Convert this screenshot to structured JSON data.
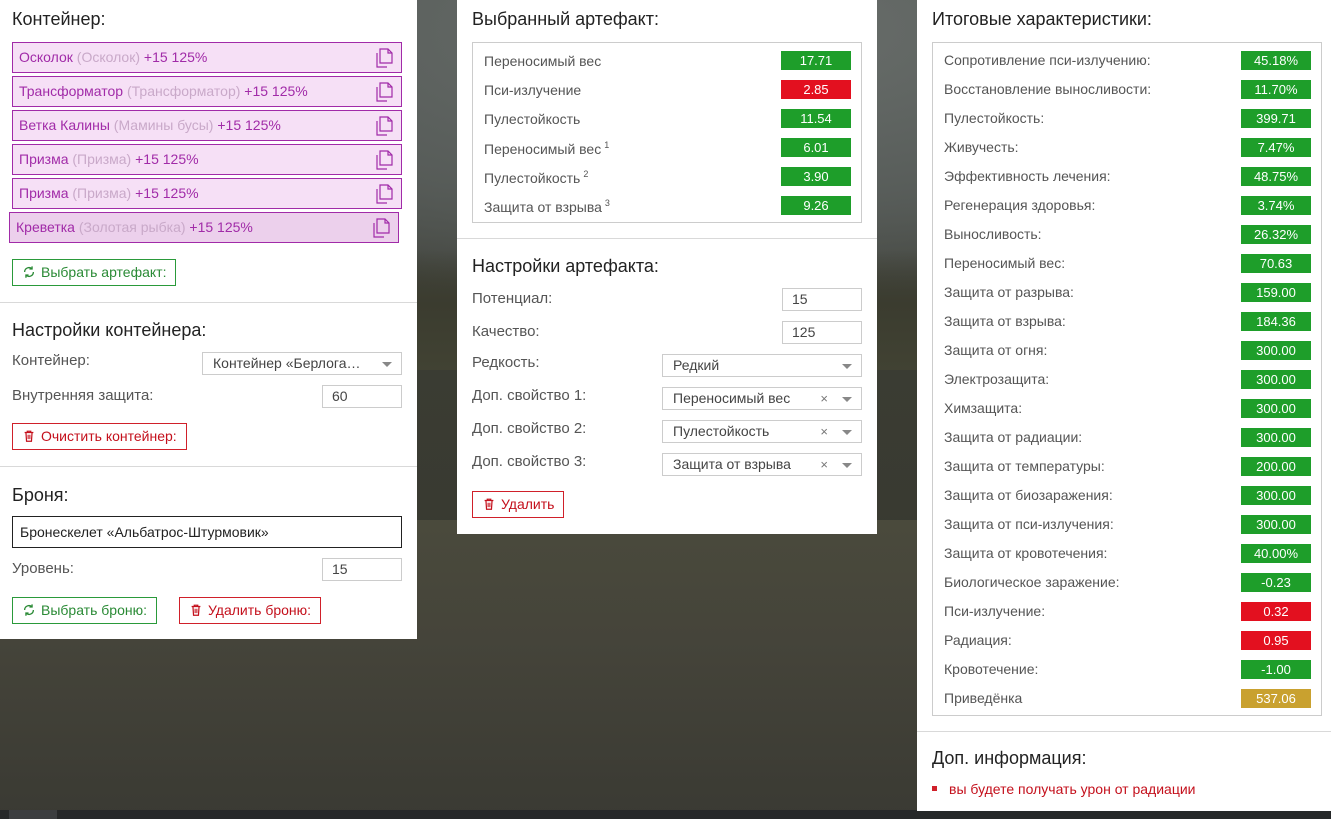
{
  "container_section": {
    "title": "Контейнер:",
    "artifacts": [
      {
        "name": "Осколок",
        "sub": "(Осколок)",
        "bonus": "+15 125%"
      },
      {
        "name": "Трансформатор",
        "sub": "(Трансформатор)",
        "bonus": "+15 125%"
      },
      {
        "name": "Ветка Калины",
        "sub": "(Мамины бусы)",
        "bonus": "+15 125%"
      },
      {
        "name": "Призма",
        "sub": "(Призма)",
        "bonus": "+15 125%"
      },
      {
        "name": "Призма",
        "sub": "(Призма)",
        "bonus": "+15 125%"
      },
      {
        "name": "Креветка",
        "sub": "(Золотая рыбка)",
        "bonus": "+15 125%"
      }
    ],
    "select_artifact_label": "Выбрать артефакт:"
  },
  "container_settings": {
    "title": "Настройки контейнера:",
    "container_label": "Контейнер:",
    "container_value": "Контейнер «Берлога…",
    "inner_protection_label": "Внутренняя защита:",
    "inner_protection_value": "60",
    "clear_label": "Очистить контейнер:"
  },
  "armor": {
    "title": "Броня:",
    "name": "Бронескелет «Альбатрос-Штурмовик»",
    "level_label": "Уровень:",
    "level_value": "15",
    "select_label": "Выбрать броню:",
    "delete_label": "Удалить броню:"
  },
  "selected_artifact": {
    "title": "Выбранный артефакт:",
    "stats": [
      {
        "name": "Переносимый вес",
        "sup": "",
        "value": "17.71",
        "color": "green"
      },
      {
        "name": "Пси-излучение",
        "sup": "",
        "value": "2.85",
        "color": "red"
      },
      {
        "name": "Пулестойкость",
        "sup": "",
        "value": "11.54",
        "color": "green"
      },
      {
        "name": "Переносимый вес",
        "sup": "1",
        "value": "6.01",
        "color": "green"
      },
      {
        "name": "Пулестойкость",
        "sup": "2",
        "value": "3.90",
        "color": "green"
      },
      {
        "name": "Защита от взрыва",
        "sup": "3",
        "value": "9.26",
        "color": "green"
      }
    ]
  },
  "artifact_settings": {
    "title": "Настройки артефакта:",
    "potential_label": "Потенциал:",
    "potential_value": "15",
    "quality_label": "Качество:",
    "quality_value": "125",
    "rarity_label": "Редкость:",
    "rarity_value": "Редкий",
    "extra1_label": "Доп. свойство 1:",
    "extra1_value": "Переносимый вес",
    "extra2_label": "Доп. свойство 2:",
    "extra2_value": "Пулестойкость",
    "extra3_label": "Доп. свойство 3:",
    "extra3_value": "Защита от взрыва",
    "clear_symbol": "×",
    "delete_label": "Удалить"
  },
  "total_stats": {
    "title": "Итоговые характеристики:",
    "stats": [
      {
        "name": "Сопротивление пси-излучению:",
        "value": "45.18%",
        "color": "green"
      },
      {
        "name": "Восстановление выносливости:",
        "value": "11.70%",
        "color": "green"
      },
      {
        "name": "Пулестойкость:",
        "value": "399.71",
        "color": "green"
      },
      {
        "name": "Живучесть:",
        "value": "7.47%",
        "color": "green"
      },
      {
        "name": "Эффективность лечения:",
        "value": "48.75%",
        "color": "green"
      },
      {
        "name": "Регенерация здоровья:",
        "value": "3.74%",
        "color": "green"
      },
      {
        "name": "Выносливость:",
        "value": "26.32%",
        "color": "green"
      },
      {
        "name": "Переносимый вес:",
        "value": "70.63",
        "color": "green"
      },
      {
        "name": "Защита от разрыва:",
        "value": "159.00",
        "color": "green"
      },
      {
        "name": "Защита от взрыва:",
        "value": "184.36",
        "color": "green"
      },
      {
        "name": "Защита от огня:",
        "value": "300.00",
        "color": "green"
      },
      {
        "name": "Электрозащита:",
        "value": "300.00",
        "color": "green"
      },
      {
        "name": "Химзащита:",
        "value": "300.00",
        "color": "green"
      },
      {
        "name": "Защита от радиации:",
        "value": "300.00",
        "color": "green"
      },
      {
        "name": "Защита от температуры:",
        "value": "200.00",
        "color": "green"
      },
      {
        "name": "Защита от биозаражения:",
        "value": "300.00",
        "color": "green"
      },
      {
        "name": "Защита от пси-излучения:",
        "value": "300.00",
        "color": "green"
      },
      {
        "name": "Защита от кровотечения:",
        "value": "40.00%",
        "color": "green"
      },
      {
        "name": "Биологическое заражение:",
        "value": "-0.23",
        "color": "green"
      },
      {
        "name": "Пси-излучение:",
        "value": "0.32",
        "color": "red"
      },
      {
        "name": "Радиация:",
        "value": "0.95",
        "color": "red"
      },
      {
        "name": "Кровотечение:",
        "value": "-1.00",
        "color": "green"
      },
      {
        "name": "Приведёнка",
        "value": "537.06",
        "color": "gold"
      }
    ]
  },
  "extra_info": {
    "title": "Доп. информация:",
    "items": [
      "вы будете получать урон от радиации"
    ]
  },
  "colors": {
    "artifact_accent": "#a12ba8",
    "green": "#1e9e2a",
    "red": "#e3101f",
    "gold": "#c9a12f"
  }
}
